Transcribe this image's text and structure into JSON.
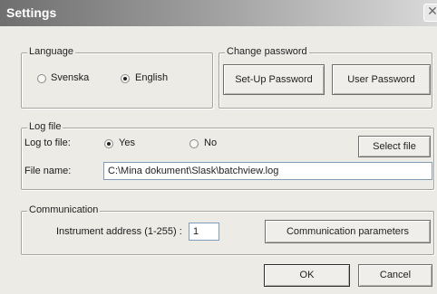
{
  "window": {
    "title": "Settings",
    "close_glyph": "✕"
  },
  "language": {
    "legend": "Language",
    "options": [
      {
        "label": "Svenska",
        "checked": false
      },
      {
        "label": "English",
        "checked": true
      }
    ]
  },
  "password": {
    "legend": "Change password",
    "setup_label": "Set-Up Password",
    "user_label": "User Password"
  },
  "logfile": {
    "legend": "Log file",
    "log_to_file_label": "Log to file:",
    "yes_label": "Yes",
    "yes_checked": true,
    "no_label": "No",
    "no_checked": false,
    "select_file_label": "Select file",
    "file_name_label": "File name:",
    "file_name_value": "C:\\Mina dokument\\Slask\\batchview.log"
  },
  "communication": {
    "legend": "Communication",
    "address_label": "Instrument address (1-255) :",
    "address_value": "1",
    "params_label": "Communication parameters"
  },
  "footer": {
    "ok_label": "OK",
    "cancel_label": "Cancel"
  }
}
